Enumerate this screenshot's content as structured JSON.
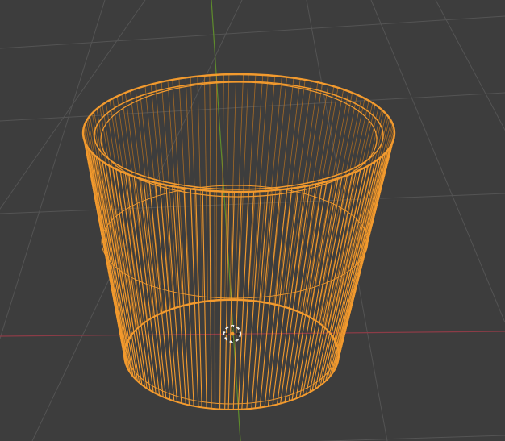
{
  "viewport": {
    "mode": "wireframe",
    "selected": true
  },
  "colors": {
    "background": "#3d3d3d",
    "grid": "#545454",
    "x_axis": "#8c3c47",
    "y_axis": "#5e8c2c",
    "wire": "#f29a2e",
    "wire_dark": "#c97a1c",
    "cursor_ring": "#f0f0f0",
    "cursor_ring_alt": "#d0342c"
  },
  "icons": {
    "cursor": "3d-cursor-icon",
    "origin": "object-origin-icon"
  }
}
